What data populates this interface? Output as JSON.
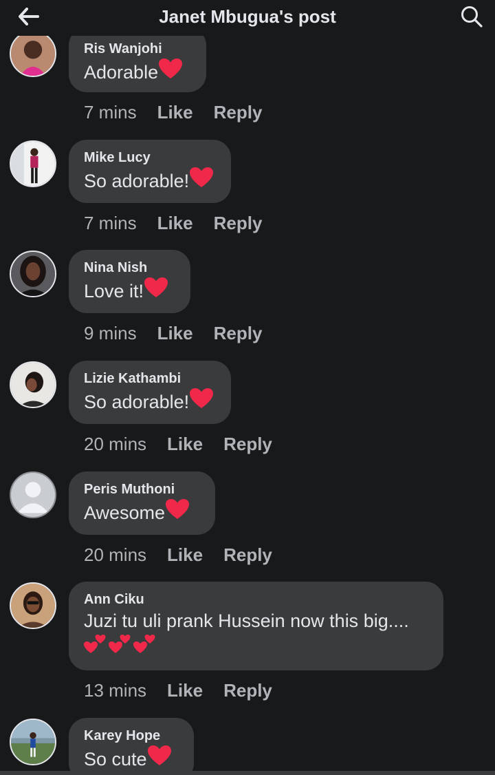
{
  "header": {
    "title": "Janet Mbugua's post",
    "back_icon": "back-arrow-icon",
    "search_icon": "search-icon"
  },
  "colors": {
    "background": "#18191a",
    "bubble": "#3a3b3c",
    "text": "#e4e6eb",
    "secondary_text": "#b0b3b8",
    "heart": "#f02849"
  },
  "comments": [
    {
      "author": "Ris Wanjohi",
      "text": "Adorable ",
      "time": "7 mins",
      "like": "Like",
      "reply": "Reply",
      "emoji": "heart-icon"
    },
    {
      "author": "Mike Lucy",
      "text": "So adorable!",
      "time": "7 mins",
      "like": "Like",
      "reply": "Reply",
      "emoji": "heart-icon"
    },
    {
      "author": "Nina Nish",
      "text": "Love it! ",
      "time": "9 mins",
      "like": "Like",
      "reply": "Reply",
      "emoji": "heart-icon"
    },
    {
      "author": "Lizie Kathambi",
      "text": "So adorable!",
      "time": "20 mins",
      "like": "Like",
      "reply": "Reply",
      "emoji": "heart-icon"
    },
    {
      "author": "Peris Muthoni",
      "text": "Awesome ",
      "time": "20 mins",
      "like": "Like",
      "reply": "Reply",
      "emoji": "heart-icon"
    },
    {
      "author": "Ann Ciku",
      "text": "Juzi tu uli prank Hussein  now this big....",
      "time": "13 mins",
      "like": "Like",
      "reply": "Reply",
      "emoji": "two-hearts-icon"
    },
    {
      "author": "Karey Hope",
      "text": "So cute ",
      "time": "",
      "like": "",
      "reply": "",
      "emoji": "heart-icon"
    }
  ]
}
